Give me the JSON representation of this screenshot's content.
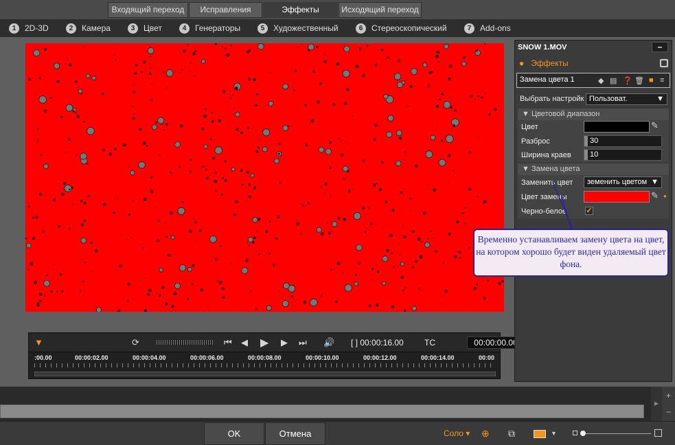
{
  "top_tabs": [
    {
      "label": "Входящий переход"
    },
    {
      "label": "Исправления"
    },
    {
      "label": "Эффекты"
    },
    {
      "label": "Исходящий переход"
    }
  ],
  "categories": [
    {
      "num": "1",
      "label": "2D-3D"
    },
    {
      "num": "2",
      "label": "Камера"
    },
    {
      "num": "3",
      "label": "Цвет"
    },
    {
      "num": "4",
      "label": "Генераторы"
    },
    {
      "num": "5",
      "label": "Художественный"
    },
    {
      "num": "6",
      "label": "Стереоскопический"
    },
    {
      "num": "7",
      "label": "Add-ons"
    }
  ],
  "transport": {
    "duration": "[ ] 00:00:16.00",
    "tc_label": "TC",
    "timecode": "00:00:00.00",
    "ruler": [
      ":00.00",
      "00:00:02.00",
      "00:00:04.00",
      "00:00:06.00",
      "00:00:08.00",
      "00:00:10.00",
      "00:00:12.00",
      "00:00:14.00",
      "00:00"
    ]
  },
  "panel": {
    "title": "SNOW 1.MOV",
    "min_label": "–",
    "effects_label": "Эффекты",
    "effect_name": "Замена цвета 1",
    "preset_label": "Выбрать настройк",
    "preset_value": "Пользоват.",
    "range_section": "Цветовой диапазон",
    "color_label": "Цвет",
    "spread_label": "Разброс",
    "spread_value": "30",
    "edge_label": "Ширина краев",
    "edge_value": "10",
    "replace_section": "Замена цвета",
    "replace_label": "Заменить цвет",
    "replace_value": "земенить цветом",
    "new_color_label": "Цвет замены",
    "bw_label": "Черно-белое",
    "colors": {
      "color_swatch": "#000000",
      "replace_swatch": "#ff0000",
      "accent": "#f3961f"
    }
  },
  "callout": {
    "text": "Временно устанавливаем замену цвета на цвет, на котором хорошо будет виден удаляемый цвет фона."
  },
  "bottom": {
    "ok": "OK",
    "cancel": "Отмена",
    "solo": "Соло"
  }
}
